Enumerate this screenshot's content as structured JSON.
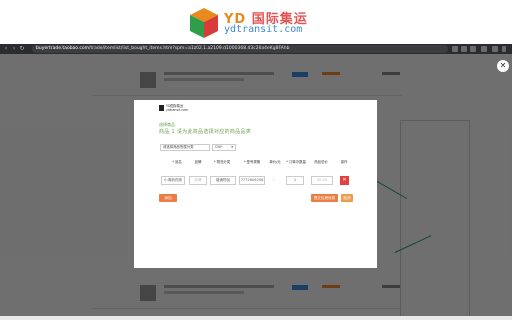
{
  "promo": {
    "brand_yd": "YD",
    "brand_cn": "国际集运",
    "brand_sub": "ydtransit.com"
  },
  "browser": {
    "url_host": "buyertrade.taobao.com",
    "url_rest": "/trade/itemlist/list_bought_items.htm?spm=a1z02.1.a2109.d1000368.43c26a4eKg8FAhb"
  },
  "modal": {
    "brand_line1": "YD国际集运",
    "brand_line2": "ydtransit.com",
    "title": "选择商品",
    "category": "商品 1 请为此商品选择对应的商品品类",
    "area_select": "请选择商品所属分类",
    "currency_select": "CNY",
    "headers": [
      "* 品名",
      "品牌",
      "* 物流分类",
      "* 型号规格",
      "单价/元",
      "* 订单中数量",
      "商品总价",
      "操作"
    ],
    "row": {
      "name": "小清新衣服",
      "brand": "品牌",
      "category": "普通物品",
      "model": "7772606208",
      "dash": "-",
      "unit_price": "40",
      "qty": "1",
      "total": "40.00"
    },
    "add_label": "添加",
    "post_label": "提交包裹信息",
    "cancel_label": "取消",
    "delete_label": "✕"
  },
  "colors": {
    "accent_orange": "#ec7c43",
    "delete_red": "#e04141",
    "title_green": "#6aa34a"
  }
}
